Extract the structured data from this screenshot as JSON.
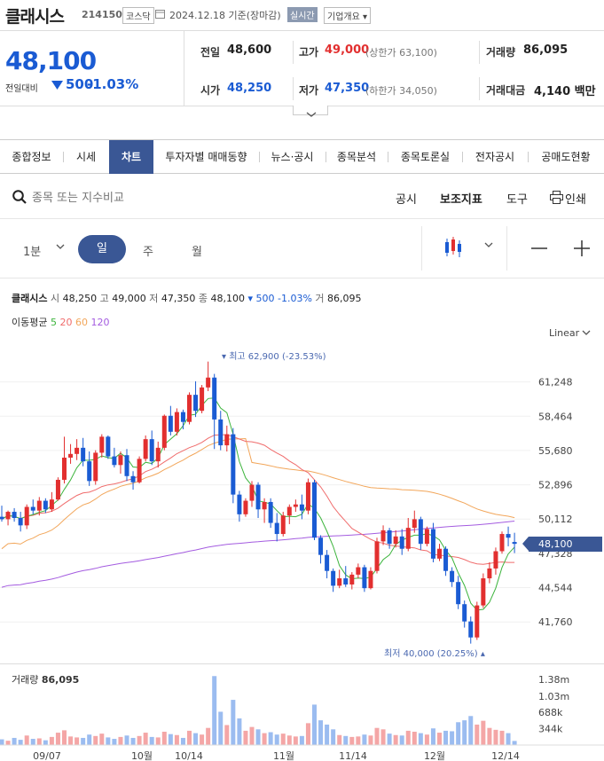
{
  "header": {
    "name": "클래시스",
    "code": "214150",
    "market": "코스닥",
    "date": "2024.12.18 기준(장마감)",
    "realtime": "실시간",
    "overview": "기업개요 ▾"
  },
  "quote": {
    "price": "48,100",
    "prev_label": "전일대비",
    "change": "500",
    "change_pct": "-1.03%",
    "prev_close_label": "전일",
    "prev_close": "48,600",
    "high_label": "고가",
    "high": "49,000",
    "upper_limit": "(상한가 63,100)",
    "volume_label": "거래량",
    "volume": "86,095",
    "open_label": "시가",
    "open": "48,250",
    "low_label": "저가",
    "low": "47,350",
    "lower_limit": "(하한가 34,050)",
    "value_label": "거래대금",
    "value": "4,140 백만"
  },
  "tabs": [
    "종합정보",
    "시세",
    "차트",
    "투자자별 매매동향",
    "뉴스·공시",
    "종목분석",
    "종목토론실",
    "전자공시",
    "공매도현황"
  ],
  "toolbar": {
    "search_placeholder": "종목 또는 지수비교",
    "disclosure": "공시",
    "indicators": "보조지표",
    "tools": "도구",
    "print": "인쇄"
  },
  "period": {
    "minute": "1분",
    "day": "일",
    "week": "주",
    "month": "월"
  },
  "legend": {
    "name": "클래시스",
    "open_l": "시",
    "open": "48,250",
    "high_l": "고",
    "high": "49,000",
    "low_l": "저",
    "low": "47,350",
    "close_l": "종",
    "close": "48,100",
    "chg": "▾ 500 -1.03%",
    "vol_l": "거",
    "vol": "86,095",
    "ma_label": "이동평균",
    "ma": [
      "5",
      "20",
      "60",
      "120"
    ],
    "scale": "Linear"
  },
  "colors": {
    "up": "#e22f2f",
    "down": "#1a5bd3",
    "ma5": "#3cb43c",
    "ma20": "#f06c6c",
    "ma60": "#f2a65a",
    "ma120": "#a45ce0",
    "accent": "#3a5795"
  },
  "chart_data": {
    "type": "candlestick",
    "y_ticks": [
      "61,248",
      "58,464",
      "55,680",
      "52,896",
      "50,112",
      "47,328",
      "44,544",
      "41,760"
    ],
    "x_ticks": [
      "09/07",
      "10월",
      "10/14",
      "11월",
      "11/14",
      "12월",
      "12/14"
    ],
    "ylim": [
      39300,
      64200
    ],
    "current_price_label": "48,100",
    "max_note": "▾ 최고 62,900 (-23.53%)",
    "min_note": "최저 40,000 (20.25%) ▴",
    "ohlc": [
      [
        50300,
        51200,
        49900,
        50100
      ],
      [
        50100,
        50800,
        49600,
        50700
      ],
      [
        50700,
        51000,
        49900,
        50200
      ],
      [
        50200,
        50700,
        49100,
        49600
      ],
      [
        49600,
        51300,
        49300,
        51100
      ],
      [
        51100,
        51700,
        50500,
        50800
      ],
      [
        50800,
        51900,
        50400,
        51600
      ],
      [
        51600,
        51800,
        50600,
        50900
      ],
      [
        50900,
        52300,
        50700,
        51700
      ],
      [
        51700,
        53500,
        51600,
        53300
      ],
      [
        53300,
        56800,
        53000,
        55100
      ],
      [
        55100,
        56200,
        54600,
        55400
      ],
      [
        55400,
        56600,
        54900,
        55900
      ],
      [
        55900,
        56700,
        54400,
        54800
      ],
      [
        54800,
        55600,
        52800,
        53200
      ],
      [
        53200,
        55700,
        52900,
        55500
      ],
      [
        55500,
        57000,
        55100,
        56800
      ],
      [
        56800,
        56900,
        55000,
        55200
      ],
      [
        55200,
        55900,
        54300,
        54500
      ],
      [
        54500,
        55600,
        53800,
        55300
      ],
      [
        55300,
        55800,
        53200,
        53600
      ],
      [
        53600,
        54000,
        52500,
        53100
      ],
      [
        53100,
        55200,
        53000,
        55000
      ],
      [
        55000,
        56900,
        54800,
        56600
      ],
      [
        56600,
        57300,
        54500,
        54800
      ],
      [
        54800,
        56400,
        54300,
        55900
      ],
      [
        55900,
        58600,
        55700,
        58500
      ],
      [
        58500,
        59300,
        56900,
        57200
      ],
      [
        57200,
        59100,
        56900,
        58800
      ],
      [
        58800,
        59000,
        57400,
        58000
      ],
      [
        58000,
        60400,
        57800,
        60200
      ],
      [
        60200,
        61300,
        58400,
        58900
      ],
      [
        58900,
        61000,
        58700,
        60800
      ],
      [
        60800,
        62900,
        60500,
        61600
      ],
      [
        61600,
        61900,
        55800,
        58200
      ],
      [
        58200,
        58900,
        55700,
        56100
      ],
      [
        56100,
        57700,
        55600,
        57000
      ],
      [
        57000,
        57500,
        51400,
        52100
      ],
      [
        52100,
        52400,
        49900,
        50500
      ],
      [
        50500,
        51800,
        50300,
        51600
      ],
      [
        51600,
        53200,
        51100,
        52900
      ],
      [
        52900,
        53100,
        50200,
        50900
      ],
      [
        50900,
        51800,
        49800,
        51500
      ],
      [
        51500,
        51800,
        49400,
        49800
      ],
      [
        49800,
        50600,
        48300,
        48900
      ],
      [
        48900,
        50700,
        48700,
        50400
      ],
      [
        50400,
        51300,
        49700,
        51100
      ],
      [
        51100,
        51700,
        50700,
        51300
      ],
      [
        51300,
        52100,
        50100,
        50800
      ],
      [
        50800,
        53400,
        50500,
        53100
      ],
      [
        53100,
        53300,
        48400,
        48600
      ],
      [
        48600,
        48800,
        46500,
        47200
      ],
      [
        47200,
        47600,
        45300,
        45900
      ],
      [
        45900,
        46100,
        44200,
        44700
      ],
      [
        44700,
        46000,
        44500,
        45300
      ],
      [
        45300,
        46300,
        44600,
        44800
      ],
      [
        44800,
        45800,
        44400,
        45600
      ],
      [
        45600,
        46500,
        45300,
        46200
      ],
      [
        46200,
        46400,
        44200,
        44500
      ],
      [
        44500,
        46200,
        44400,
        45900
      ],
      [
        45900,
        48600,
        45700,
        48300
      ],
      [
        48300,
        49600,
        48000,
        49200
      ],
      [
        49200,
        49400,
        47700,
        48100
      ],
      [
        48100,
        49200,
        47800,
        48700
      ],
      [
        48700,
        49300,
        47200,
        47700
      ],
      [
        47700,
        50200,
        47500,
        49400
      ],
      [
        49400,
        50800,
        49000,
        50100
      ],
      [
        50100,
        50300,
        47600,
        48100
      ],
      [
        48100,
        49500,
        47900,
        49300
      ],
      [
        49300,
        49800,
        46600,
        46900
      ],
      [
        46900,
        48100,
        46700,
        47700
      ],
      [
        47700,
        47900,
        45500,
        45900
      ],
      [
        45900,
        46200,
        44600,
        45000
      ],
      [
        45000,
        45500,
        42800,
        43200
      ],
      [
        43200,
        43500,
        41300,
        41800
      ],
      [
        41800,
        42200,
        40000,
        40500
      ],
      [
        40500,
        43400,
        40300,
        43100
      ],
      [
        43100,
        45700,
        42900,
        45300
      ],
      [
        45300,
        46600,
        44900,
        46100
      ],
      [
        46100,
        47800,
        45600,
        47500
      ],
      [
        47500,
        49100,
        47300,
        48900
      ],
      [
        48900,
        49500,
        47900,
        48600
      ],
      [
        48250,
        49000,
        47350,
        48100
      ]
    ],
    "volume_ticks": [
      "1.38m",
      "1.03m",
      "688k",
      "344k"
    ],
    "volume_label": "거래량",
    "volume_value": "86,095",
    "volume": [
      120000,
      90000,
      150000,
      110000,
      200000,
      130000,
      140000,
      100000,
      170000,
      260000,
      310000,
      180000,
      160000,
      150000,
      220000,
      190000,
      240000,
      160000,
      130000,
      170000,
      200000,
      150000,
      190000,
      260000,
      170000,
      160000,
      280000,
      230000,
      210000,
      150000,
      300000,
      250000,
      220000,
      360000,
      1450000,
      700000,
      420000,
      950000,
      560000,
      300000,
      380000,
      330000,
      250000,
      270000,
      220000,
      240000,
      200000,
      180000,
      190000,
      460000,
      850000,
      520000,
      430000,
      330000,
      210000,
      190000,
      170000,
      180000,
      220000,
      200000,
      360000,
      330000,
      240000,
      210000,
      200000,
      300000,
      280000,
      250000,
      220000,
      350000,
      260000,
      300000,
      290000,
      480000,
      520000,
      610000,
      430000,
      510000,
      360000,
      320000,
      300000,
      250000,
      86095
    ]
  }
}
